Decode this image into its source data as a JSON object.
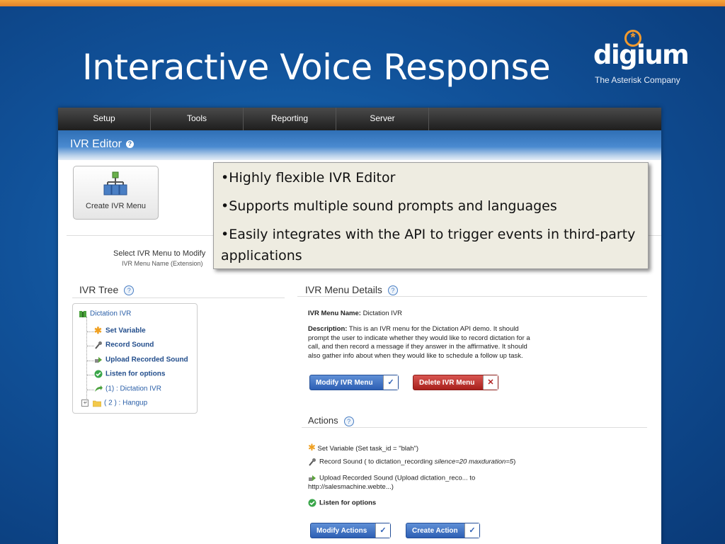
{
  "slide": {
    "title": "Interactive Voice Response",
    "logo_word": "digium",
    "logo_tagline": "The Asterisk Company"
  },
  "nav": {
    "tabs": [
      "Setup",
      "Tools",
      "Reporting",
      "Server"
    ]
  },
  "editor": {
    "title": "IVR Editor",
    "create_button": "Create IVR Menu",
    "select_label": "Select IVR Menu to Modify",
    "select_sub": "IVR Menu Name (Extension)"
  },
  "overlay": {
    "bullets": [
      "•Highly flexible IVR Editor",
      "•Supports multiple sound prompts and languages",
      "•Easily integrates with the API to trigger events in third-party applications"
    ]
  },
  "tree": {
    "title": "IVR Tree",
    "items": [
      "Dictation IVR",
      "Set Variable",
      "Record Sound",
      "Upload Recorded Sound",
      "Listen for options",
      "(1) : Dictation IVR",
      "( 2 ) : Hangup"
    ]
  },
  "details": {
    "title": "IVR Menu Details",
    "name_label": "IVR Menu Name:",
    "name_value": "Dictation IVR",
    "desc_label": "Description:",
    "desc_lines": [
      "This is an IVR menu for the Dictation API demo. It should",
      "prompt the user to indicate whether they would like to record dictation for a",
      "call, and then record a message if they answer in the affirmative. It should",
      "also gather info about when they would like to schedule a follow up task."
    ],
    "modify_button": "Modify IVR Menu",
    "delete_button": "Delete IVR Menu"
  },
  "actions": {
    "title": "Actions",
    "set_variable": "Set Variable (Set task_id = \"blah\")",
    "record_prefix": "Record Sound ( to dictation_recording ",
    "record_params": "silence=20 maxduration=5",
    "record_suffix": ")",
    "upload_line1": "Upload Recorded Sound (Upload dictation_reco... to",
    "upload_line2": "http://salesmachine.webte...)",
    "listen": "Listen for options",
    "modify_button": "Modify Actions",
    "create_button": "Create Action"
  },
  "colors": {
    "accent_orange": "#f29a2e",
    "nav_dark": "#1e1e1e",
    "header_blue": "#2f6fb5",
    "button_blue": "#2d5fb4",
    "button_red": "#a8201c"
  }
}
